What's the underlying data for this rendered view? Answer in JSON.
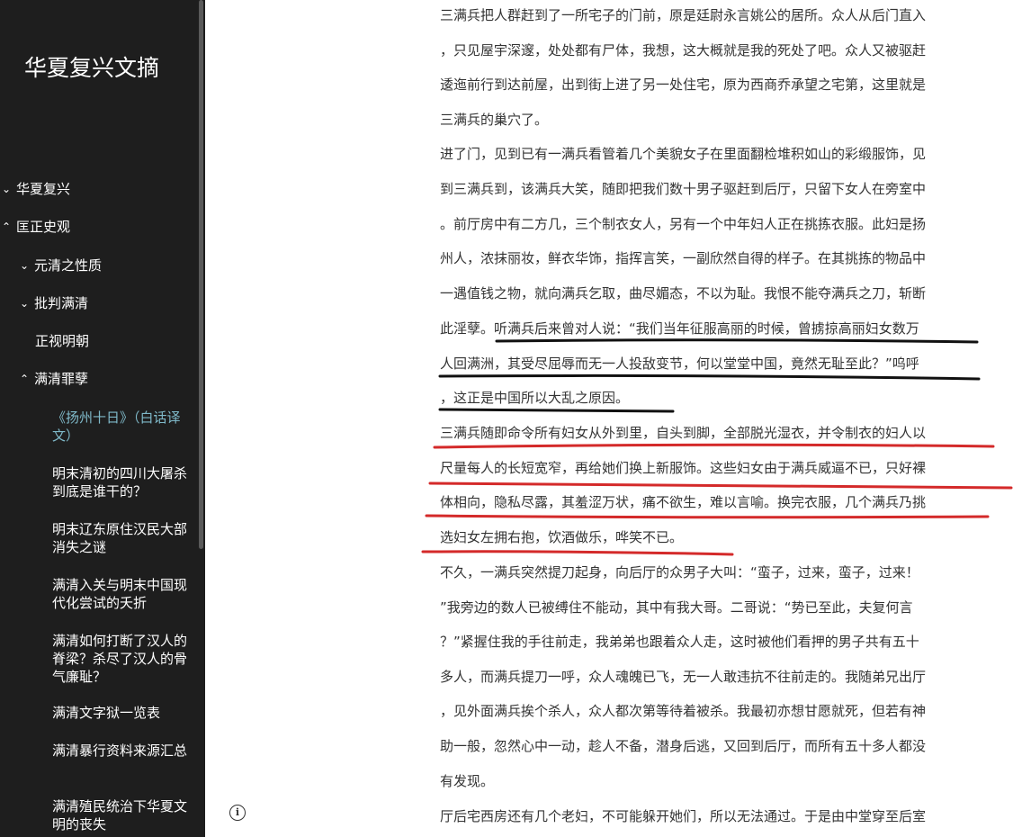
{
  "sidebar": {
    "title": "华夏复兴文摘",
    "items": [
      {
        "label": "华夏复兴",
        "chevron": "⌄"
      },
      {
        "label": "匡正史观",
        "chevron": "⌃"
      },
      {
        "label": "元清之性质",
        "chevron": "⌄"
      },
      {
        "label": "批判满清",
        "chevron": "⌄"
      },
      {
        "label": "正视明朝",
        "chevron": ""
      },
      {
        "label": "满清罪孽",
        "chevron": "⌃"
      },
      {
        "label": "《扬州十日》（白话译文）",
        "chevron": ""
      },
      {
        "label": "明末清初的四川大屠杀到底是谁干的？",
        "chevron": ""
      },
      {
        "label": "明末辽东原住汉民大部消失之谜",
        "chevron": ""
      },
      {
        "label": "满清入关与明末中国现代化尝试的夭折",
        "chevron": ""
      },
      {
        "label": "满清如何打断了汉人的脊梁？杀尽了汉人的骨气廉耻？",
        "chevron": ""
      },
      {
        "label": "满清文字狱一览表",
        "chevron": ""
      },
      {
        "label": "满清暴行资料来源汇总",
        "chevron": ""
      },
      {
        "label": "满清殖民统治下华夏文明的丧失",
        "chevron": ""
      }
    ]
  },
  "article": {
    "lines": [
      "三满兵把人群赶到了一所宅子的门前，原是廷尉永言姚公的居所。众人从后门直入",
      "，只见屋宇深邃，处处都有尸体，我想，这大概就是我的死处了吧。众人又被驱赶",
      "逶迤前行到达前屋，出到街上进了另一处住宅，原为西商乔承望之宅第，这里就是",
      "三满兵的巢穴了。",
      "进了门，见到已有一满兵看管着几个美貌女子在里面翻检堆积如山的彩缎服饰，见",
      "到三满兵到，该满兵大笑，随即把我们数十男子驱赶到后厅，只留下女人在旁室中",
      "。前厅房中有二方几，三个制衣女人，另有一个中年妇人正在挑拣衣服。此妇是扬",
      "州人，浓抹丽妆，鲜衣华饰，指挥言笑，一副欣然自得的样子。在其挑拣的物品中",
      "一遇值钱之物，就向满兵乞取，曲尽媚态，不以为耻。我恨不能夺满兵之刀，斩断",
      "此淫孽。听满兵后来曾对人说：“我们当年征服高丽的时候，曾掳掠高丽妇女数万",
      "人回满洲，其受尽屈辱而无一人投敌变节，何以堂堂中国，竟然无耻至此？”呜呼",
      "，这正是中国所以大乱之原因。",
      "三满兵随即命令所有妇女从外到里，自头到脚，全部脱光湿衣，并令制衣的妇人以",
      "尺量每人的长短宽窄，再给她们换上新服饰。这些妇女由于满兵威逼不已，只好裸",
      "体相向，隐私尽露，其羞涩万状，痛不欲生，难以言喻。换完衣服，几个满兵乃挑",
      "选妇女左拥右抱，饮酒做乐，哗笑不已。",
      "不久，一满兵突然提刀起身，向后厅的众男子大叫：“蛮子，过来，蛮子，过来！",
      "”我旁边的数人已被缚住不能动，其中有我大哥。二哥说：“势已至此，夫复何言",
      "？”紧握住我的手往前走，我弟弟也跟着众人走，这时被他们看押的男子共有五十",
      "多人，而满兵提刀一呼，众人魂魄已飞，无一人敢违抗不往前走的。我随弟兄出厅",
      "，见外面满兵挨个杀人，众人都次第等待着被杀。我最初亦想甘愿就死，但若有神",
      "助一般，忽然心中一动，趁人不备，潜身后逃，又回到后厅，而所有五十多人都没",
      "有发现。",
      "厅后宅西房还有几个老妇，不可能躲开她们，所以无法通过。于是由中堂穿至后室"
    ]
  },
  "icons": {
    "info": "info-icon",
    "info_glyph": "i"
  },
  "colors": {
    "sidebar_bg": "#1e1e1e",
    "active_link": "#7fb9c9",
    "underline_black": "#111111",
    "underline_red": "#d42a2a"
  }
}
